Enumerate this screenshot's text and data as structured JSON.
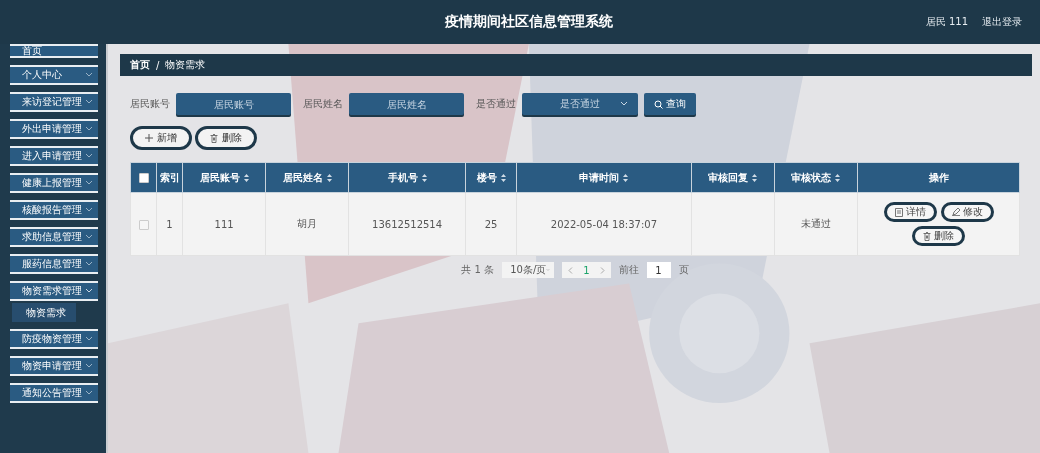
{
  "header": {
    "title": "疫情期间社区信息管理系统",
    "user": "居民 111",
    "logout": "退出登录"
  },
  "sidebar": {
    "items": [
      {
        "label": "首页",
        "has_children": false
      },
      {
        "label": "个人中心",
        "has_children": true,
        "expanded": false
      },
      {
        "label": "来访登记管理",
        "has_children": true,
        "expanded": false
      },
      {
        "label": "外出申请管理",
        "has_children": true,
        "expanded": false
      },
      {
        "label": "进入申请管理",
        "has_children": true,
        "expanded": false
      },
      {
        "label": "健康上报管理",
        "has_children": true,
        "expanded": false
      },
      {
        "label": "核酸报告管理",
        "has_children": true,
        "expanded": false
      },
      {
        "label": "求助信息管理",
        "has_children": true,
        "expanded": false
      },
      {
        "label": "服药信息管理",
        "has_children": true,
        "expanded": false
      },
      {
        "label": "物资需求管理",
        "has_children": true,
        "expanded": true,
        "children": [
          {
            "label": "物资需求",
            "selected": true
          }
        ]
      },
      {
        "label": "防疫物资管理",
        "has_children": true,
        "expanded": false
      },
      {
        "label": "物资申请管理",
        "has_children": true,
        "expanded": false
      },
      {
        "label": "通知公告管理",
        "has_children": true,
        "expanded": false
      }
    ]
  },
  "breadcrumb": [
    "首页",
    "/",
    "物资需求"
  ],
  "filters": [
    {
      "kind": "input",
      "label": "居民账号",
      "placeholder": "居民账号"
    },
    {
      "kind": "input",
      "label": "居民姓名",
      "placeholder": "居民姓名"
    },
    {
      "kind": "select",
      "label": "是否通过",
      "placeholder": "是否通过"
    }
  ],
  "search_button": "查询",
  "actions": [
    {
      "kind": "add",
      "label": "新增"
    },
    {
      "kind": "delete",
      "label": "删除"
    }
  ],
  "table": {
    "columns": [
      {
        "label": "索引",
        "sortable": false
      },
      {
        "label": "居民账号",
        "sortable": true
      },
      {
        "label": "居民姓名",
        "sortable": true
      },
      {
        "label": "手机号",
        "sortable": true
      },
      {
        "label": "楼号",
        "sortable": true
      },
      {
        "label": "申请时间",
        "sortable": true
      },
      {
        "label": "审核回复",
        "sortable": true
      },
      {
        "label": "审核状态",
        "sortable": true
      },
      {
        "label": "操作",
        "sortable": false
      }
    ],
    "all_checked": false,
    "rows": [
      {
        "checked": false,
        "cells": [
          "1",
          "111",
          "胡月",
          "13612512514",
          "25",
          "2022-05-04 18:37:07",
          "",
          "未通过"
        ],
        "buttons": [
          {
            "kind": "detail",
            "label": "详情"
          },
          {
            "kind": "edit",
            "label": "修改"
          },
          {
            "kind": "delete",
            "label": "删除"
          }
        ]
      }
    ]
  },
  "pagination": {
    "total": "共 1 条",
    "page_size": "10条/页",
    "pages": [
      {
        "label": "1",
        "selected": true
      }
    ],
    "goto_label": "前往",
    "goto_value": "1",
    "page_unit": "页"
  }
}
